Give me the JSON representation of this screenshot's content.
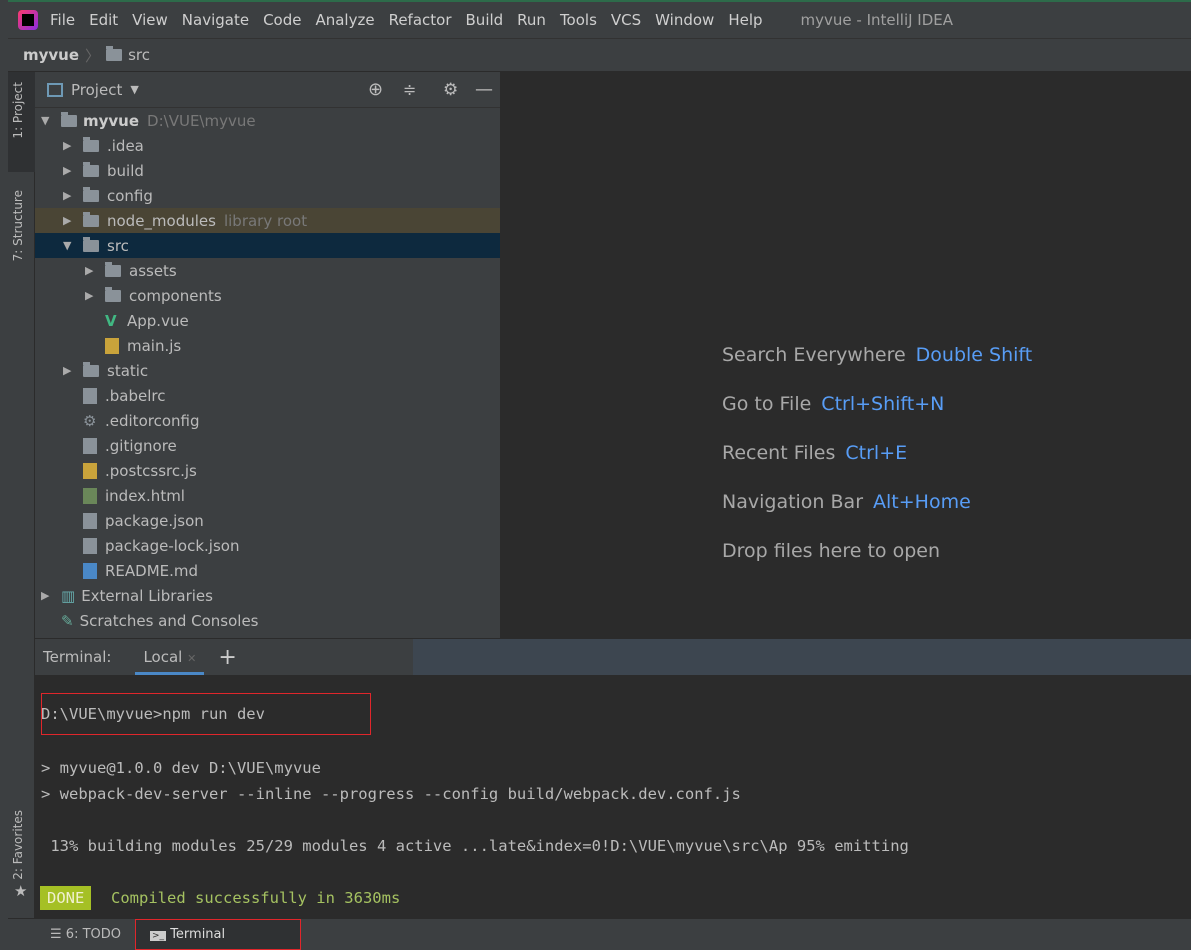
{
  "window": {
    "title": "myvue - IntelliJ IDEA"
  },
  "menu": [
    "File",
    "Edit",
    "View",
    "Navigate",
    "Code",
    "Analyze",
    "Refactor",
    "Build",
    "Run",
    "Tools",
    "VCS",
    "Window",
    "Help"
  ],
  "breadcrumb": {
    "project": "myvue",
    "folder": "src"
  },
  "side_tabs": {
    "project": "1: Project",
    "structure": "7: Structure",
    "favorites": "2: Favorites"
  },
  "project_panel": {
    "title": "Project",
    "root": {
      "name": "myvue",
      "path": "D:\\VUE\\myvue"
    },
    "items": [
      {
        "name": ".idea",
        "type": "folder",
        "depth": 1,
        "expanded": false
      },
      {
        "name": "build",
        "type": "folder",
        "depth": 1,
        "expanded": false
      },
      {
        "name": "config",
        "type": "folder",
        "depth": 1,
        "expanded": false
      },
      {
        "name": "node_modules",
        "type": "folder",
        "depth": 1,
        "expanded": false,
        "note": "library root"
      },
      {
        "name": "src",
        "type": "folder",
        "depth": 1,
        "expanded": true,
        "selected": true
      },
      {
        "name": "assets",
        "type": "folder",
        "depth": 2,
        "expanded": false
      },
      {
        "name": "components",
        "type": "folder",
        "depth": 2,
        "expanded": false
      },
      {
        "name": "App.vue",
        "type": "vue",
        "depth": 2
      },
      {
        "name": "main.js",
        "type": "js",
        "depth": 2
      },
      {
        "name": "static",
        "type": "folder",
        "depth": 1,
        "expanded": false
      },
      {
        "name": ".babelrc",
        "type": "config",
        "depth": 1
      },
      {
        "name": ".editorconfig",
        "type": "gear",
        "depth": 1
      },
      {
        "name": ".gitignore",
        "type": "config",
        "depth": 1
      },
      {
        "name": ".postcssrc.js",
        "type": "js",
        "depth": 1
      },
      {
        "name": "index.html",
        "type": "html",
        "depth": 1
      },
      {
        "name": "package.json",
        "type": "config",
        "depth": 1
      },
      {
        "name": "package-lock.json",
        "type": "config",
        "depth": 1
      },
      {
        "name": "README.md",
        "type": "md",
        "depth": 1
      }
    ],
    "external": "External Libraries",
    "scratches": "Scratches and Consoles"
  },
  "editor_hints": [
    {
      "label": "Search Everywhere",
      "key": "Double Shift"
    },
    {
      "label": "Go to File",
      "key": "Ctrl+Shift+N"
    },
    {
      "label": "Recent Files",
      "key": "Ctrl+E"
    },
    {
      "label": "Navigation Bar",
      "key": "Alt+Home"
    },
    {
      "label": "Drop files here to open",
      "key": ""
    }
  ],
  "terminal": {
    "label": "Terminal:",
    "tab": "Local",
    "lines": {
      "cmd": "D:\\VUE\\myvue>npm run dev",
      "l1": "> myvue@1.0.0 dev D:\\VUE\\myvue",
      "l2": "> webpack-dev-server --inline --progress --config build/webpack.dev.conf.js",
      "l3": " 13% building modules 25/29 modules 4 active ...late&index=0!D:\\VUE\\myvue\\src\\Ap 95% emitting",
      "done": "DONE",
      "compiled": "Compiled successfully in 3630ms"
    }
  },
  "bottom_tabs": {
    "todo": "6: TODO",
    "terminal": "Terminal"
  },
  "colors": {
    "accent": "#589df6",
    "done_bg": "#a5c025",
    "done_text": "#a5c261",
    "highlight_box": "#e0262b"
  }
}
